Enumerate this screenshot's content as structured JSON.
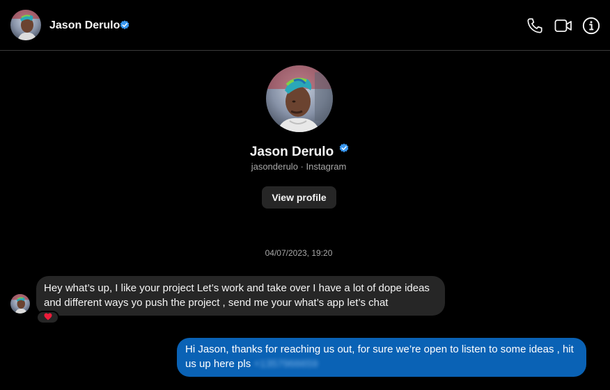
{
  "header": {
    "name": "Jason Derulo",
    "verified": true,
    "icons": [
      "phone-icon",
      "video-call-icon",
      "info-icon"
    ]
  },
  "profile": {
    "name": "Jason Derulo",
    "subtitle": "jasonderulo · Instagram",
    "view_profile_label": "View profile"
  },
  "conversation": {
    "timestamp": "04/07/2023, 19:20",
    "messages": [
      {
        "direction": "incoming",
        "text": "Hey what’s up, I like your project Let’s work and take over I have a lot of dope ideas and different ways yo push the project , send me your what’s app let’s chat",
        "reaction": "❤"
      },
      {
        "direction": "outgoing",
        "text": "Hi Jason, thanks for reaching us out, for sure we’re open to listen to some ideas , hit us up here pls",
        "redacted_text": "+1357966659"
      }
    ]
  },
  "colors": {
    "background": "#000000",
    "incoming_bubble": "#262626",
    "outgoing_bubble": "#0a62b5",
    "verified": "#3897f0",
    "reaction": "#ed1c3a"
  }
}
